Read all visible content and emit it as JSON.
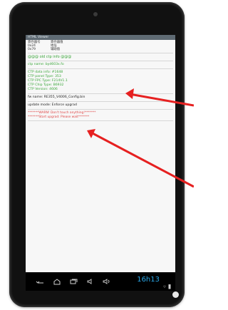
{
  "app": {
    "window_title": "HTML Viewer"
  },
  "register_table": {
    "headers": [
      "寄存器号",
      "寄存器值"
    ],
    "rows": [
      [
        "0x24",
        "地址"
      ],
      [
        "0x79",
        "辅助值"
      ]
    ]
  },
  "ctp_info": {
    "heading": "@@@ old ctp info @@@",
    "lines": [
      "ctp name: byd603x.fo",
      "CTP data info: #1648",
      "CTP panel Type: 353",
      "CTP FPC Type: F214V1.1",
      "CTP Chip Type: B6932",
      "CTP Version: 4606"
    ]
  },
  "upgrade": {
    "fw_name": "fw name: RE355_V4006_Config.bin",
    "update_mode": "update mode: Enforce upgrad",
    "warning": "*******WARN! Don't touch anything!*******",
    "status": "*******Start upgrad: Please wait*******"
  },
  "navbar": {
    "clock": "16h13",
    "icons": [
      "back-icon",
      "home-icon",
      "recent-apps-icon",
      "volume-down-icon",
      "volume-up-icon",
      "wifi-icon",
      "battery-icon"
    ]
  },
  "colors": {
    "ctp_text": "#3aa63a",
    "warning_text": "#e04848",
    "clock": "#2aa8e8",
    "arrow": "#e62020"
  }
}
